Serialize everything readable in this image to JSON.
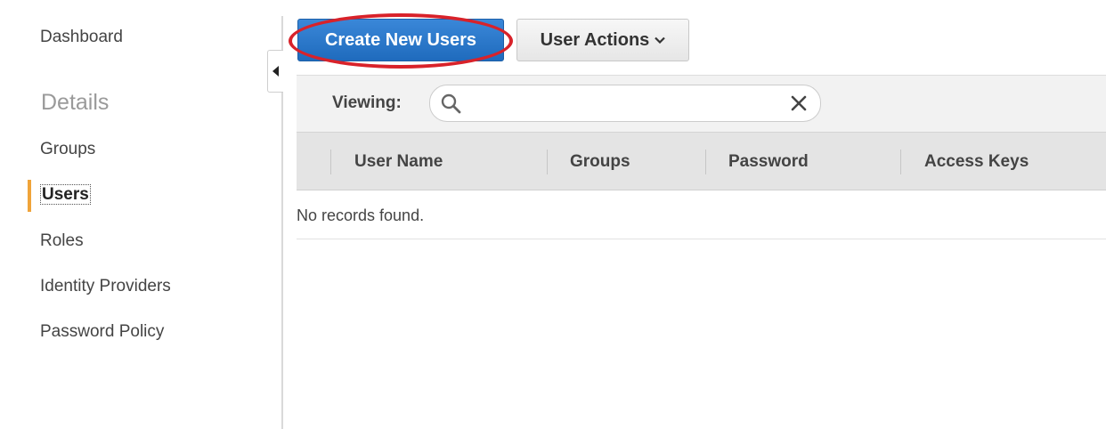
{
  "sidebar": {
    "dashboard": "Dashboard",
    "section_heading": "Details",
    "items": [
      {
        "label": "Groups"
      },
      {
        "label": "Users"
      },
      {
        "label": "Roles"
      },
      {
        "label": "Identity Providers"
      },
      {
        "label": "Password Policy"
      }
    ],
    "active_item": "Users",
    "active_marker_color": "#f0a43a"
  },
  "toolbar": {
    "create_button_label": "Create New Users",
    "user_actions_label": "User Actions",
    "primary_color": "#2a78cc",
    "highlight_color": "#d8222a"
  },
  "filter": {
    "viewing_label": "Viewing:",
    "search_value": ""
  },
  "table": {
    "columns": [
      "User Name",
      "Groups",
      "Password",
      "Access Keys"
    ],
    "empty_message": "No records found."
  },
  "icons": {
    "search": "search-icon",
    "clear": "close-icon",
    "dropdown": "chevron-down-icon",
    "collapse": "caret-left-icon"
  }
}
